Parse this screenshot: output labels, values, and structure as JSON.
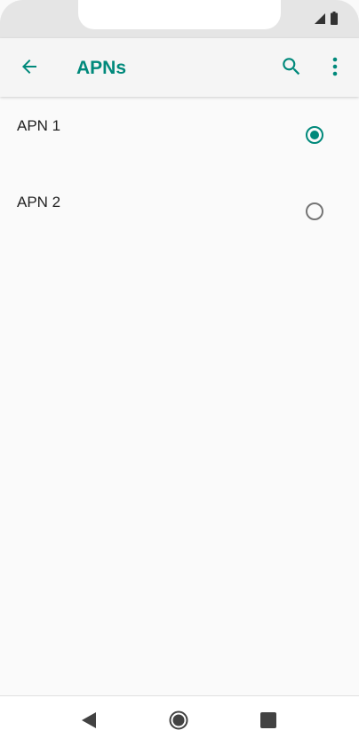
{
  "status_bar": {
    "icons": [
      "signal-icon",
      "battery-icon"
    ]
  },
  "app_bar": {
    "title": "APNs",
    "back_icon": "arrow-back-icon",
    "search_icon": "search-icon",
    "more_icon": "more-vert-icon"
  },
  "apns": [
    {
      "label": "APN 1",
      "selected": true
    },
    {
      "label": "APN 2",
      "selected": false
    }
  ],
  "nav_bar": {
    "icons": [
      "nav-back-icon",
      "nav-home-icon",
      "nav-recents-icon"
    ]
  },
  "colors": {
    "accent": "#00897b",
    "radio_unchecked": "#757575",
    "text": "#222222",
    "background": "#fafafa",
    "app_bar": "#f5f5f5",
    "status_bar": "#e5e5e5",
    "nav_icons": "#424242"
  }
}
